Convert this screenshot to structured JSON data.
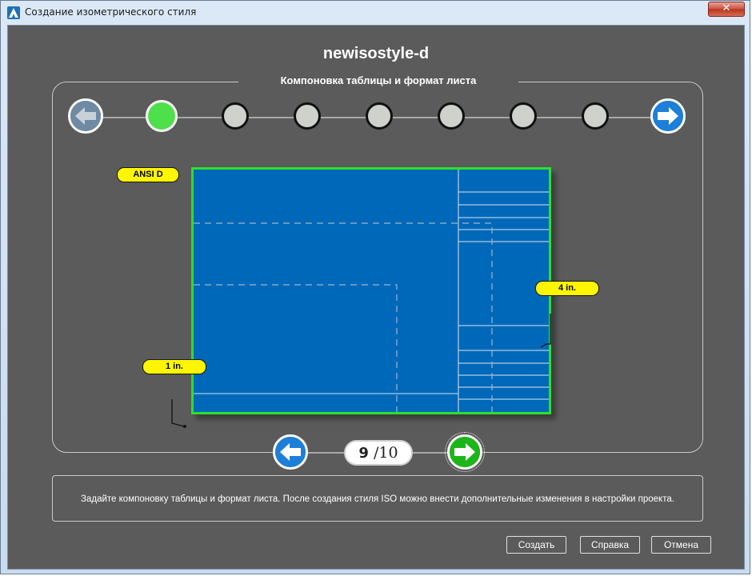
{
  "window": {
    "title": "Создание изометрического стиля",
    "close_label": "✕"
  },
  "header": {
    "style_name": "newisostyle-d"
  },
  "panel": {
    "title": "Компоновка таблицы и формат листа"
  },
  "steps": {
    "total_dots": 7,
    "active_index": 0
  },
  "sheet": {
    "format_tag": "ANSI D",
    "right_tag": "4 in.",
    "left_tag": "1 in."
  },
  "pager": {
    "current": "9",
    "separator": "/",
    "total": "10"
  },
  "description": "Задайте компоновку таблицы и формат листа. После создания стиля ISO можно внести дополнительные изменения в настройки проекта.",
  "buttons": {
    "create": "Создать",
    "help": "Справка",
    "cancel": "Отмена"
  },
  "colors": {
    "sheet": "#0068b8",
    "border": "#2ee02a",
    "tag": "#fff600",
    "background": "#5b5b5b",
    "active_step": "#4ee04a"
  }
}
